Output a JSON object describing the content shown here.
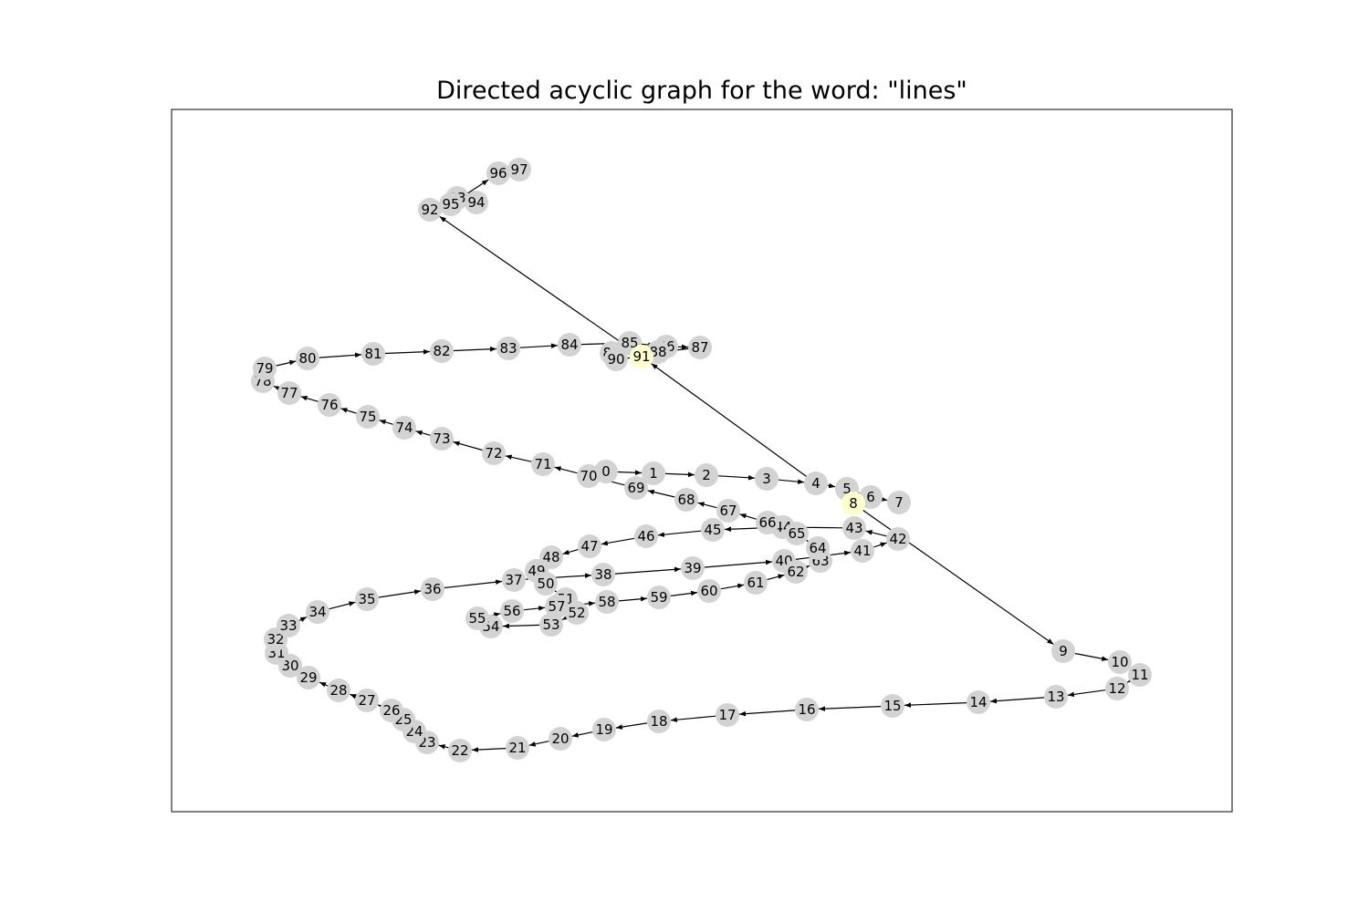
{
  "title": "Directed acyclic graph for the word: \"lines\"",
  "colors": {
    "node": "#d3d3d3",
    "highlight": "#ffffcc",
    "edge": "#000000",
    "frame": "#000000"
  },
  "highlighted_nodes": [
    "8",
    "91"
  ],
  "nodes": [
    "0",
    "1",
    "2",
    "3",
    "4",
    "5",
    "6",
    "7",
    "8",
    "9",
    "10",
    "11",
    "12",
    "13",
    "14",
    "15",
    "16",
    "17",
    "18",
    "19",
    "20",
    "21",
    "22",
    "23",
    "24",
    "25",
    "26",
    "27",
    "28",
    "29",
    "30",
    "31",
    "32",
    "33",
    "34",
    "35",
    "36",
    "37",
    "38",
    "39",
    "40",
    "41",
    "42",
    "43",
    "44",
    "45",
    "46",
    "47",
    "48",
    "49",
    "50",
    "51",
    "52",
    "53",
    "54",
    "55",
    "56",
    "57",
    "58",
    "59",
    "60",
    "61",
    "62",
    "63",
    "64",
    "65",
    "66",
    "67",
    "68",
    "69",
    "70",
    "71",
    "72",
    "73",
    "74",
    "75",
    "76",
    "77",
    "78",
    "79",
    "80",
    "81",
    "82",
    "83",
    "84",
    "85",
    "86",
    "87",
    "88",
    "89",
    "90",
    "91",
    "92",
    "93",
    "94",
    "95",
    "96",
    "97"
  ],
  "edges": [
    [
      "0",
      "1"
    ],
    [
      "1",
      "2"
    ],
    [
      "2",
      "3"
    ],
    [
      "3",
      "4"
    ],
    [
      "4",
      "5"
    ],
    [
      "5",
      "6"
    ],
    [
      "6",
      "7"
    ],
    [
      "4",
      "91"
    ],
    [
      "8",
      "9"
    ],
    [
      "9",
      "10"
    ],
    [
      "10",
      "11"
    ],
    [
      "11",
      "12"
    ],
    [
      "12",
      "13"
    ],
    [
      "13",
      "14"
    ],
    [
      "14",
      "15"
    ],
    [
      "15",
      "16"
    ],
    [
      "16",
      "17"
    ],
    [
      "17",
      "18"
    ],
    [
      "18",
      "19"
    ],
    [
      "19",
      "20"
    ],
    [
      "20",
      "21"
    ],
    [
      "21",
      "22"
    ],
    [
      "22",
      "23"
    ],
    [
      "23",
      "24"
    ],
    [
      "24",
      "25"
    ],
    [
      "25",
      "26"
    ],
    [
      "26",
      "27"
    ],
    [
      "27",
      "28"
    ],
    [
      "28",
      "29"
    ],
    [
      "29",
      "30"
    ],
    [
      "30",
      "31"
    ],
    [
      "31",
      "32"
    ],
    [
      "32",
      "33"
    ],
    [
      "33",
      "34"
    ],
    [
      "34",
      "35"
    ],
    [
      "35",
      "36"
    ],
    [
      "36",
      "37"
    ],
    [
      "37",
      "38"
    ],
    [
      "38",
      "39"
    ],
    [
      "39",
      "40"
    ],
    [
      "40",
      "41"
    ],
    [
      "41",
      "42"
    ],
    [
      "42",
      "43"
    ],
    [
      "43",
      "44"
    ],
    [
      "44",
      "45"
    ],
    [
      "45",
      "46"
    ],
    [
      "46",
      "47"
    ],
    [
      "47",
      "48"
    ],
    [
      "48",
      "49"
    ],
    [
      "49",
      "50"
    ],
    [
      "50",
      "51"
    ],
    [
      "51",
      "52"
    ],
    [
      "52",
      "53"
    ],
    [
      "53",
      "54"
    ],
    [
      "54",
      "55"
    ],
    [
      "55",
      "56"
    ],
    [
      "56",
      "57"
    ],
    [
      "57",
      "58"
    ],
    [
      "58",
      "59"
    ],
    [
      "59",
      "60"
    ],
    [
      "60",
      "61"
    ],
    [
      "61",
      "62"
    ],
    [
      "62",
      "63"
    ],
    [
      "63",
      "64"
    ],
    [
      "64",
      "65"
    ],
    [
      "65",
      "66"
    ],
    [
      "66",
      "67"
    ],
    [
      "67",
      "68"
    ],
    [
      "68",
      "69"
    ],
    [
      "69",
      "70"
    ],
    [
      "70",
      "71"
    ],
    [
      "71",
      "72"
    ],
    [
      "72",
      "73"
    ],
    [
      "73",
      "74"
    ],
    [
      "74",
      "75"
    ],
    [
      "75",
      "76"
    ],
    [
      "76",
      "77"
    ],
    [
      "77",
      "78"
    ],
    [
      "78",
      "79"
    ],
    [
      "79",
      "80"
    ],
    [
      "80",
      "81"
    ],
    [
      "81",
      "82"
    ],
    [
      "82",
      "83"
    ],
    [
      "83",
      "84"
    ],
    [
      "84",
      "85"
    ],
    [
      "85",
      "86"
    ],
    [
      "86",
      "87"
    ],
    [
      "87",
      "88"
    ],
    [
      "88",
      "89"
    ],
    [
      "89",
      "90"
    ],
    [
      "90",
      "91"
    ],
    [
      "91",
      "92"
    ],
    [
      "92",
      "93"
    ],
    [
      "93",
      "94"
    ],
    [
      "94",
      "95"
    ],
    [
      "95",
      "96"
    ],
    [
      "96",
      "97"
    ]
  ]
}
